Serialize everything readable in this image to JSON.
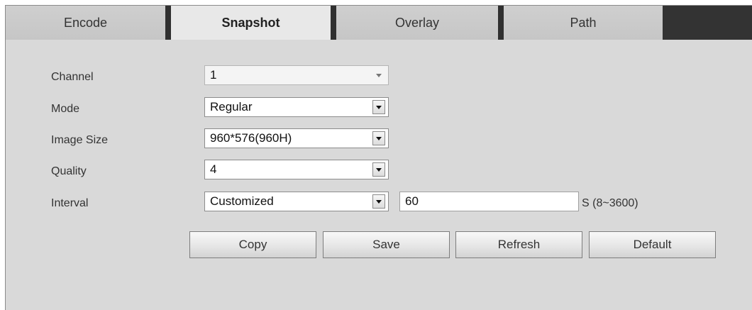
{
  "tabs": [
    {
      "label": "Encode",
      "active": false
    },
    {
      "label": "Snapshot",
      "active": true
    },
    {
      "label": "Overlay",
      "active": false
    },
    {
      "label": "Path",
      "active": false
    }
  ],
  "form": {
    "channel": {
      "label": "Channel",
      "value": "1",
      "disabled": true
    },
    "mode": {
      "label": "Mode",
      "value": "Regular"
    },
    "image_size": {
      "label": "Image Size",
      "value": "960*576(960H)"
    },
    "quality": {
      "label": "Quality",
      "value": "4"
    },
    "interval": {
      "label": "Interval",
      "value": "Customized",
      "custom_value": "60",
      "unit": "S (8~3600)"
    }
  },
  "buttons": {
    "copy": "Copy",
    "save": "Save",
    "refresh": "Refresh",
    "default": "Default"
  },
  "colors": {
    "panel_bg": "#d9d9d9",
    "tab_separator": "#303030",
    "active_tab_bg": "#e8e8e8"
  },
  "icons": {
    "dropdown": "chevron-down-icon"
  }
}
